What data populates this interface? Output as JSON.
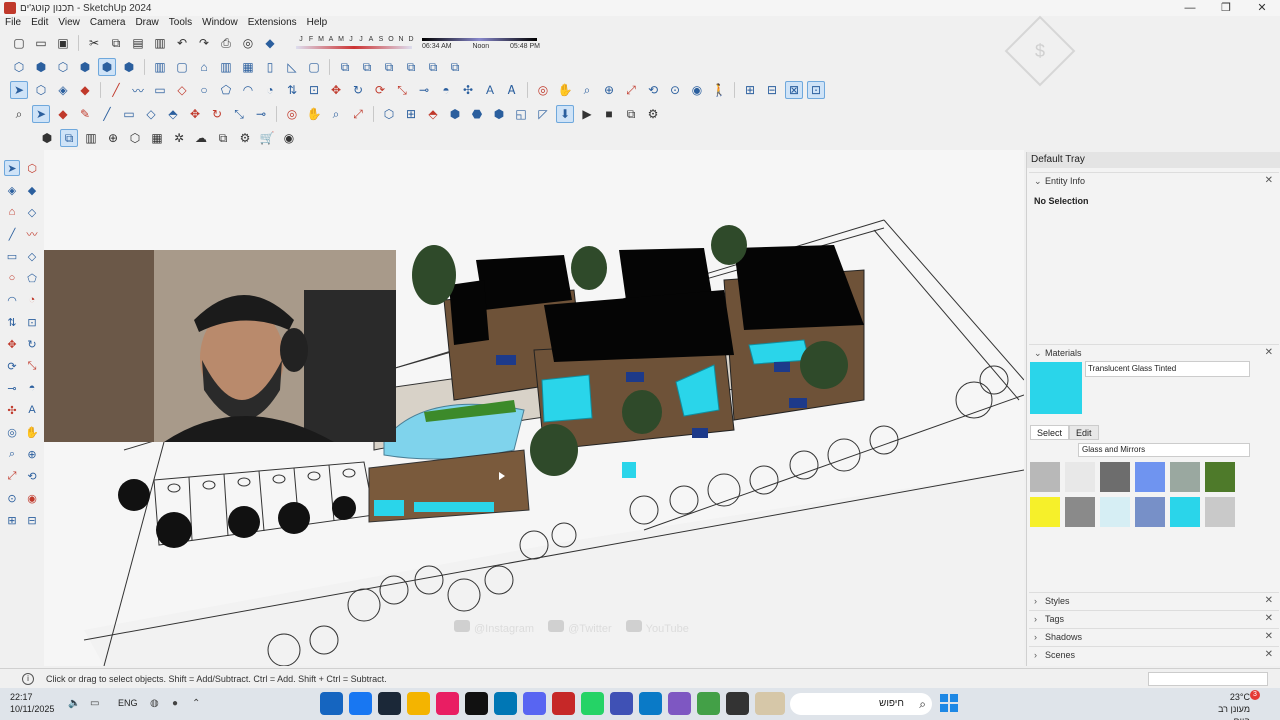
{
  "window": {
    "title": "תכנון קוטג'ים ‑ SketchUp 2024",
    "controls": [
      "—",
      "❐",
      "✕"
    ]
  },
  "menu": [
    "File",
    "Edit",
    "View",
    "Camera",
    "Draw",
    "Tools",
    "Window",
    "Extensions",
    "Help"
  ],
  "shadow_settings": {
    "months": [
      "J",
      "F",
      "M",
      "A",
      "M",
      "J",
      "J",
      "A",
      "S",
      "O",
      "N",
      "D"
    ],
    "time_start": "06:34 AM",
    "time_mid": "Noon",
    "time_end": "05:48 PM"
  },
  "tray": {
    "title": "Default Tray",
    "entity_info": {
      "label": "Entity Info",
      "selection": "No Selection"
    },
    "materials": {
      "label": "Materials",
      "current": "Translucent Glass Tinted",
      "current_color": "#2ad5ea",
      "tabs": [
        "Select",
        "Edit"
      ],
      "library": "Glass and Mirrors",
      "swatch_colors": [
        "#b8b8b8",
        "#e8e8e8",
        "#6d6d6d",
        "#6f94f0",
        "#9aa8a0",
        "#4e7a2a",
        "#f6f02a",
        "#8a8a8a",
        "#d6eef4",
        "#7790c8",
        "#2ad5ea",
        "#c9c9c9"
      ]
    },
    "collapsed_panels": [
      "Styles",
      "Tags",
      "Shadows",
      "Scenes"
    ]
  },
  "status": {
    "hint": "Click or drag to select objects. Shift = Add/Subtract. Ctrl = Add. Shift + Ctrl = Subtract."
  },
  "overlay": {
    "social": [
      "@Instagram",
      "@Twitter",
      "YouTube"
    ]
  },
  "taskbar": {
    "time": "22:17",
    "date": "10/11/2025",
    "language": "ENG",
    "search_placeholder": "חיפוש",
    "temperature": "23°C",
    "weather_text": "מעונן רב היום",
    "notification_count": "3"
  },
  "colors": {
    "accent": "#2b5f9e",
    "glass": "#2ad5ea"
  }
}
